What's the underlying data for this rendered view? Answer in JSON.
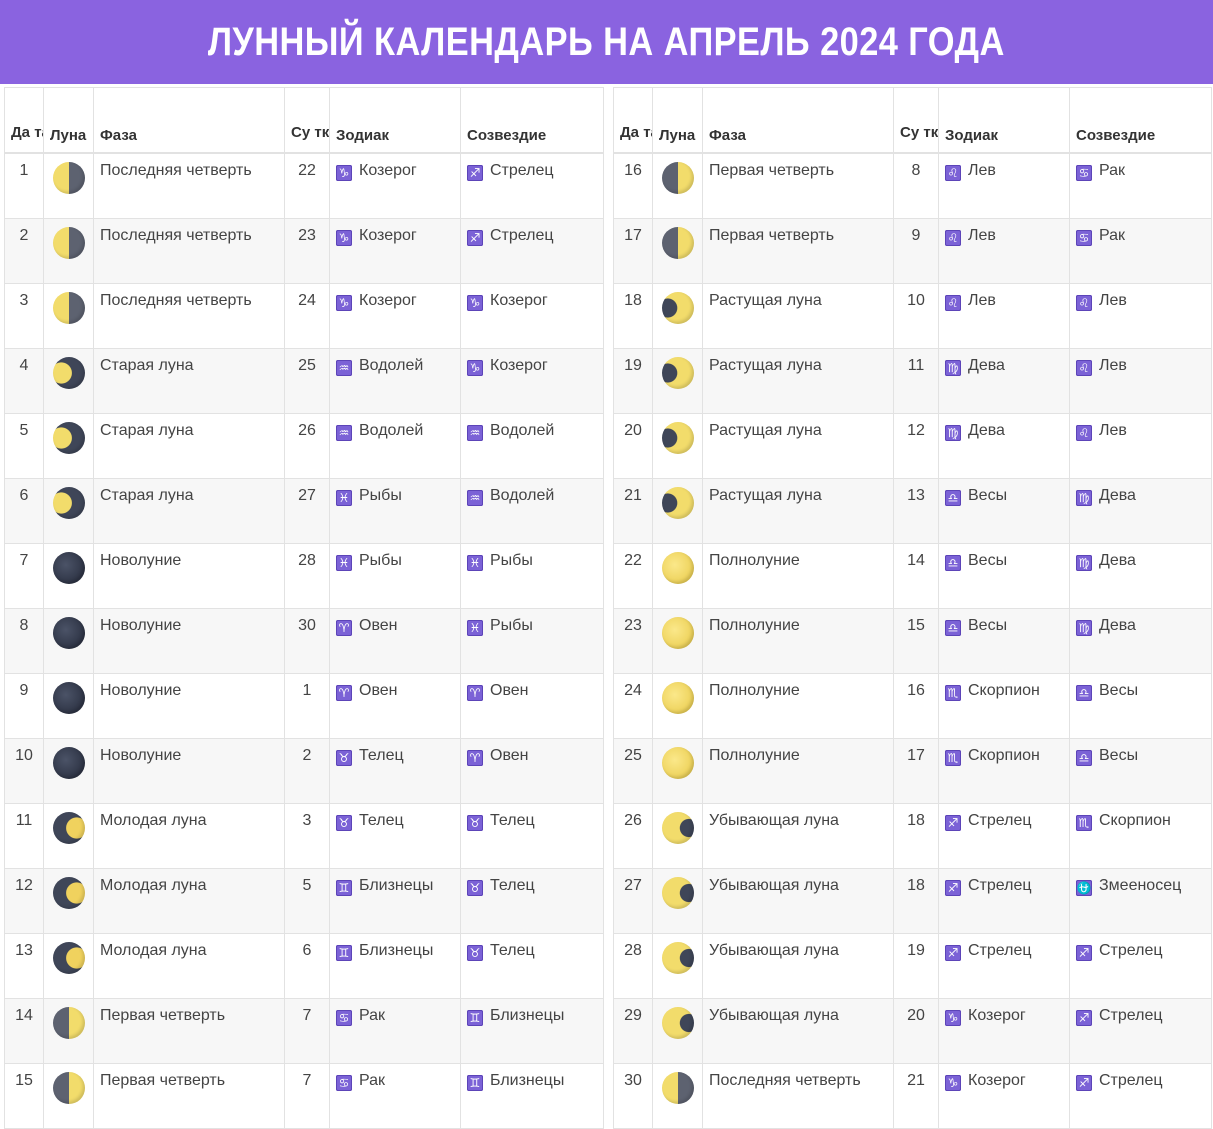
{
  "title": "ЛУННЫЙ КАЛЕНДАРЬ НА АПРЕЛЬ 2024 ГОДА",
  "colors": {
    "banner": "#8a63e0",
    "sign_badge": "#7b62d6"
  },
  "headers": {
    "date": "Да та",
    "moon": "Луна",
    "phase": "Фаза",
    "day": "Су тки",
    "zodiac": "Зодиак",
    "constellation": "Созвездие"
  },
  "sign_glyphs": {
    "Козерог": "♑",
    "Стрелец": "♐",
    "Водолей": "♒",
    "Рыбы": "♓",
    "Овен": "♈",
    "Телец": "♉",
    "Близнецы": "♊",
    "Рак": "♋",
    "Лев": "♌",
    "Дева": "♍",
    "Весы": "♎",
    "Скорпион": "♏",
    "Змееносец": "⛎"
  },
  "moon_icons": {
    "Последняя четверть": "last-quarter-moon-icon",
    "Старая луна": "waning-crescent-moon-icon",
    "Новолуние": "new-moon-icon",
    "Молодая луна": "waxing-crescent-moon-icon",
    "Первая четверть": "first-quarter-moon-icon",
    "Растущая луна": "waxing-gibbous-moon-icon",
    "Полнолуние": "full-moon-icon",
    "Убывающая луна": "waning-gibbous-moon-icon"
  },
  "rows": [
    {
      "date": "1",
      "phase": "Последняя четверть",
      "day": "22",
      "zodiac": "Козерог",
      "constellation": "Стрелец"
    },
    {
      "date": "2",
      "phase": "Последняя четверть",
      "day": "23",
      "zodiac": "Козерог",
      "constellation": "Стрелец"
    },
    {
      "date": "3",
      "phase": "Последняя четверть",
      "day": "24",
      "zodiac": "Козерог",
      "constellation": "Козерог"
    },
    {
      "date": "4",
      "phase": "Старая луна",
      "day": "25",
      "zodiac": "Водолей",
      "constellation": "Козерог"
    },
    {
      "date": "5",
      "phase": "Старая луна",
      "day": "26",
      "zodiac": "Водолей",
      "constellation": "Водолей"
    },
    {
      "date": "6",
      "phase": "Старая луна",
      "day": "27",
      "zodiac": "Рыбы",
      "constellation": "Водолей"
    },
    {
      "date": "7",
      "phase": "Новолуние",
      "day": "28",
      "zodiac": "Рыбы",
      "constellation": "Рыбы"
    },
    {
      "date": "8",
      "phase": "Новолуние",
      "day": "30",
      "zodiac": "Овен",
      "constellation": "Рыбы"
    },
    {
      "date": "9",
      "phase": "Новолуние",
      "day": "1",
      "zodiac": "Овен",
      "constellation": "Овен"
    },
    {
      "date": "10",
      "phase": "Новолуние",
      "day": "2",
      "zodiac": "Телец",
      "constellation": "Овен"
    },
    {
      "date": "11",
      "phase": "Молодая луна",
      "day": "3",
      "zodiac": "Телец",
      "constellation": "Телец"
    },
    {
      "date": "12",
      "phase": "Молодая луна",
      "day": "5",
      "zodiac": "Близнецы",
      "constellation": "Телец"
    },
    {
      "date": "13",
      "phase": "Молодая луна",
      "day": "6",
      "zodiac": "Близнецы",
      "constellation": "Телец"
    },
    {
      "date": "14",
      "phase": "Первая четверть",
      "day": "7",
      "zodiac": "Рак",
      "constellation": "Близнецы"
    },
    {
      "date": "15",
      "phase": "Первая четверть",
      "day": "7",
      "zodiac": "Рак",
      "constellation": "Близнецы"
    },
    {
      "date": "16",
      "phase": "Первая четверть",
      "day": "8",
      "zodiac": "Лев",
      "constellation": "Рак"
    },
    {
      "date": "17",
      "phase": "Первая четверть",
      "day": "9",
      "zodiac": "Лев",
      "constellation": "Рак"
    },
    {
      "date": "18",
      "phase": "Растущая луна",
      "day": "10",
      "zodiac": "Лев",
      "constellation": "Лев"
    },
    {
      "date": "19",
      "phase": "Растущая луна",
      "day": "11",
      "zodiac": "Дева",
      "constellation": "Лев"
    },
    {
      "date": "20",
      "phase": "Растущая луна",
      "day": "12",
      "zodiac": "Дева",
      "constellation": "Лев"
    },
    {
      "date": "21",
      "phase": "Растущая луна",
      "day": "13",
      "zodiac": "Весы",
      "constellation": "Дева"
    },
    {
      "date": "22",
      "phase": "Полнолуние",
      "day": "14",
      "zodiac": "Весы",
      "constellation": "Дева"
    },
    {
      "date": "23",
      "phase": "Полнолуние",
      "day": "15",
      "zodiac": "Весы",
      "constellation": "Дева"
    },
    {
      "date": "24",
      "phase": "Полнолуние",
      "day": "16",
      "zodiac": "Скорпион",
      "constellation": "Весы"
    },
    {
      "date": "25",
      "phase": "Полнолуние",
      "day": "17",
      "zodiac": "Скорпион",
      "constellation": "Весы"
    },
    {
      "date": "26",
      "phase": "Убывающая луна",
      "day": "18",
      "zodiac": "Стрелец",
      "constellation": "Скорпион"
    },
    {
      "date": "27",
      "phase": "Убывающая луна",
      "day": "18",
      "zodiac": "Стрелец",
      "constellation": "Змееносец"
    },
    {
      "date": "28",
      "phase": "Убывающая луна",
      "day": "19",
      "zodiac": "Стрелец",
      "constellation": "Стрелец"
    },
    {
      "date": "29",
      "phase": "Убывающая луна",
      "day": "20",
      "zodiac": "Козерог",
      "constellation": "Стрелец"
    },
    {
      "date": "30",
      "phase": "Последняя четверть",
      "day": "21",
      "zodiac": "Козерог",
      "constellation": "Стрелец"
    }
  ]
}
